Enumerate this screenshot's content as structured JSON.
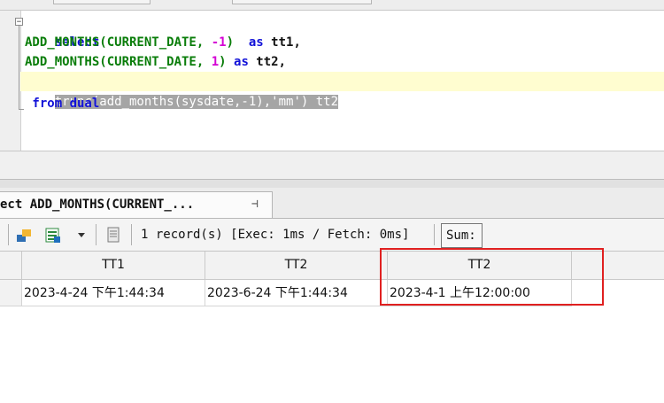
{
  "editor": {
    "fold_symbol": "−",
    "lines": {
      "l1": "select",
      "l2_fn": "ADD_MONTHS(CURRENT_DATE, ",
      "l2_num": "-1",
      "l2_end": ")  ",
      "l2_kw": "as",
      "l2_alias": " tt1,",
      "l3_fn": "ADD_MONTHS(CURRENT_DATE, ",
      "l3_num": "1",
      "l3_end": ") ",
      "l3_kw": "as",
      "l3_alias": " tt2,",
      "l4_selected": "trunc(add_months(sysdate,-1),'mm') tt2",
      "l5": " from dual"
    }
  },
  "result_tab": {
    "label": "ect ADD_MONTHS(CURRENT_...",
    "pin_symbol": "⊣"
  },
  "toolbar": {
    "status": "1 record(s) [Exec: 1ms / Fetch: 0ms]",
    "sum_label": "Sum:"
  },
  "grid": {
    "columns": [
      "TT1",
      "TT2",
      "TT2"
    ],
    "rows": [
      [
        "2023-4-24 下午1:44:34",
        "2023-6-24 下午1:44:34",
        "2023-4-1 上午12:00:00"
      ]
    ]
  },
  "colors": {
    "keyword": "#1212d8",
    "function": "#0a7d0a",
    "number": "#d400d4",
    "highlight_box": "#e02020"
  }
}
